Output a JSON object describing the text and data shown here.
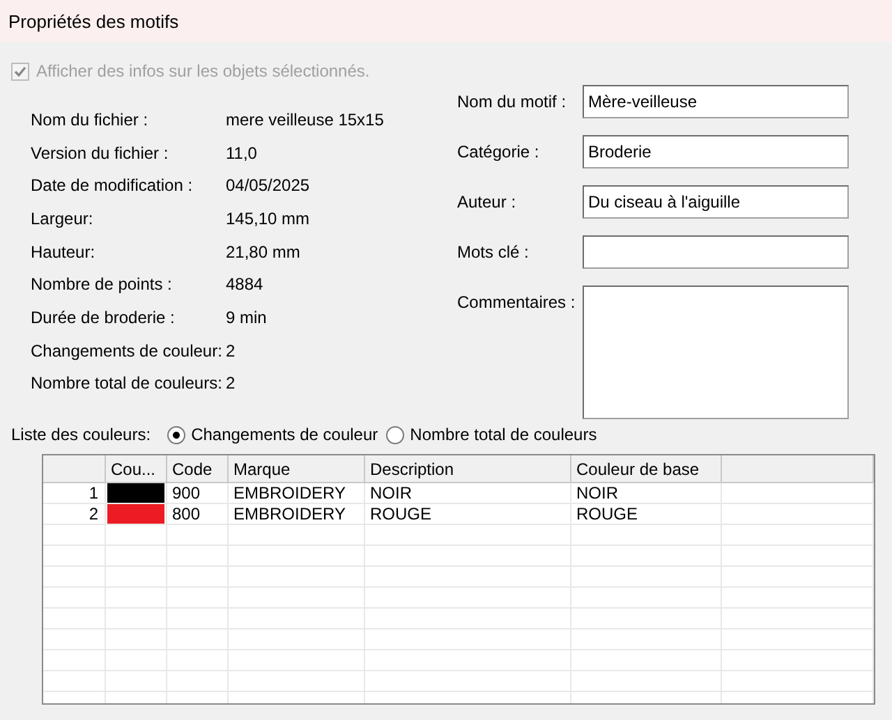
{
  "window": {
    "title": "Propriétés des motifs"
  },
  "show_info": {
    "label": "Afficher des infos sur les objets sélectionnés.",
    "checked": true,
    "disabled": true
  },
  "info": [
    {
      "label": "Nom du fichier :",
      "value": "mere veilleuse 15x15"
    },
    {
      "label": "Version du fichier :",
      "value": "11,0"
    },
    {
      "label": "Date de modification :",
      "value": "04/05/2025"
    },
    {
      "label": "Largeur:",
      "value": "145,10 mm"
    },
    {
      "label": "Hauteur:",
      "value": "21,80 mm"
    },
    {
      "label": "Nombre de points :",
      "value": "4884"
    },
    {
      "label": "Durée de broderie :",
      "value": "9 min"
    },
    {
      "label": "Changements de couleur:",
      "value": "2"
    },
    {
      "label": "Nombre total de couleurs:",
      "value": "2"
    }
  ],
  "fields": [
    {
      "label": "Nom du motif :",
      "value": "Mère-veilleuse",
      "kind": "line"
    },
    {
      "label": "Catégorie :",
      "value": "Broderie",
      "kind": "line"
    },
    {
      "label": "Auteur :",
      "value": "Du ciseau à l'aiguille",
      "kind": "line"
    },
    {
      "label": "Mots clé :",
      "kind": "line"
    },
    {
      "label": "Commentaires :",
      "kind": "multiline"
    }
  ],
  "color_list": {
    "label": "Liste des couleurs:",
    "options": [
      {
        "label": "Changements de couleur",
        "selected": true
      },
      {
        "label": "Nombre total de couleurs",
        "selected": false
      }
    ]
  },
  "table": {
    "columns": [
      "Cou...",
      "Code",
      "Marque",
      "Description",
      "Couleur de base"
    ],
    "rows": [
      {
        "index": "1",
        "color": "#000000",
        "code": "900",
        "brand": "EMBROIDERY",
        "description": "NOIR",
        "base": "NOIR"
      },
      {
        "index": "2",
        "color": "#ed1c24",
        "code": "800",
        "brand": "EMBROIDERY",
        "description": "ROUGE",
        "base": "ROUGE"
      }
    ]
  }
}
